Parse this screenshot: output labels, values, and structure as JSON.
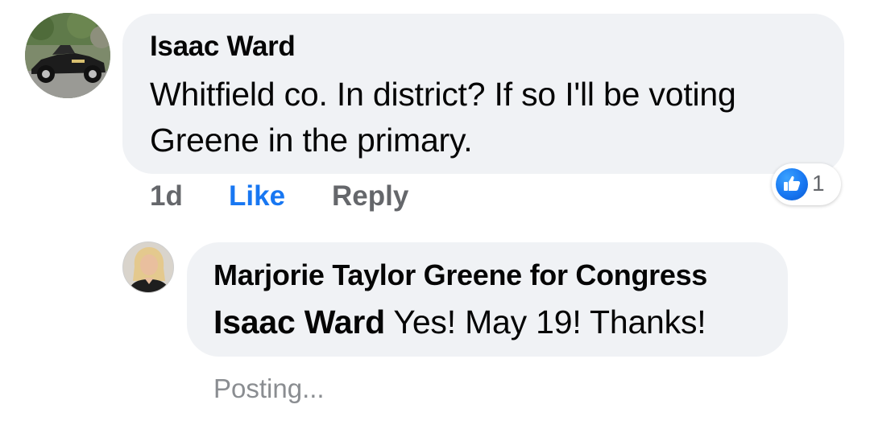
{
  "comment": {
    "author": "Isaac Ward",
    "text": "Whitfield co. In district? If so I'll be voting Greene in the primary.",
    "time": "1d",
    "like_label": "Like",
    "reply_label": "Reply",
    "reaction_count": "1",
    "colors": {
      "like_active": "#1877f2",
      "meta": "#65676b",
      "bubble": "#f0f2f5"
    }
  },
  "reply": {
    "author": "Marjorie Taylor Greene for Congress",
    "mention": "Isaac Ward",
    "text": " Yes! May 19! Thanks!",
    "status": "Posting..."
  }
}
